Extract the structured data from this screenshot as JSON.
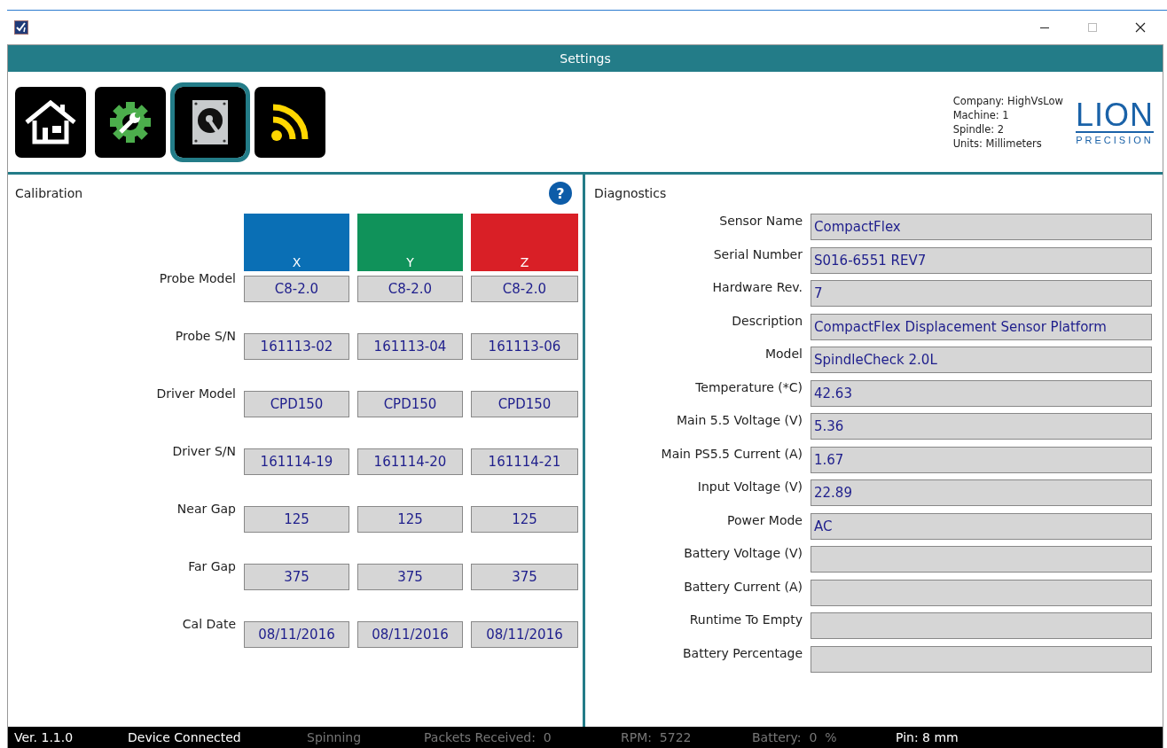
{
  "header": {
    "title": "Settings"
  },
  "toolbar": [
    {
      "kind": "home",
      "selected": false
    },
    {
      "kind": "settings",
      "selected": false
    },
    {
      "kind": "drive",
      "selected": true
    },
    {
      "kind": "signal",
      "selected": false
    }
  ],
  "info": [
    "Company: HighVsLow",
    "Machine: 1",
    "Spindle: 2",
    "Units: Millimeters"
  ],
  "logo": {
    "name": "LION",
    "tagline": "PRECISION"
  },
  "calibration": {
    "title": "Calibration",
    "help": "?",
    "columns": [
      {
        "label": "X",
        "color": "#0a6fb5"
      },
      {
        "label": "Y",
        "color": "#10925a"
      },
      {
        "label": "Z",
        "color": "#d91f26"
      }
    ],
    "rows": [
      {
        "label": "Probe Model",
        "values": [
          "C8-2.0",
          "C8-2.0",
          "C8-2.0"
        ]
      },
      {
        "label": "Probe S/N",
        "values": [
          "161113-02",
          "161113-04",
          "161113-06"
        ]
      },
      {
        "label": "Driver Model",
        "values": [
          "CPD150",
          "CPD150",
          "CPD150"
        ]
      },
      {
        "label": "Driver S/N",
        "values": [
          "161114-19",
          "161114-20",
          "161114-21"
        ]
      },
      {
        "label": "Near Gap",
        "values": [
          "125",
          "125",
          "125"
        ]
      },
      {
        "label": "Far Gap",
        "values": [
          "375",
          "375",
          "375"
        ]
      },
      {
        "label": "Cal Date",
        "values": [
          "08/11/2016",
          "08/11/2016",
          "08/11/2016"
        ]
      }
    ]
  },
  "diagnostics": {
    "title": "Diagnostics",
    "rows": [
      {
        "label": "Sensor Name",
        "value": "CompactFlex"
      },
      {
        "label": "Serial Number",
        "value": "S016-6551 REV7"
      },
      {
        "label": "Hardware Rev.",
        "value": "7"
      },
      {
        "label": "Description",
        "value": "CompactFlex Displacement Sensor Platform"
      },
      {
        "label": "Model",
        "value": "SpindleCheck 2.0L"
      },
      {
        "label": "Temperature (*C)",
        "value": "42.63"
      },
      {
        "label": "Main 5.5 Voltage (V)",
        "value": "5.36"
      },
      {
        "label": "Main PS5.5 Current (A)",
        "value": "1.67"
      },
      {
        "label": "Input Voltage (V)",
        "value": "22.89"
      },
      {
        "label": "Power Mode",
        "value": "AC"
      },
      {
        "label": "Battery Voltage (V)"
      },
      {
        "label": "Battery Current (A)"
      },
      {
        "label": "Runtime To Empty"
      },
      {
        "label": "Battery Percentage"
      }
    ]
  },
  "status_bar": [
    {
      "text": "Ver. 1.1.0",
      "active": true
    },
    {
      "text": "Device Connected",
      "active": true
    },
    {
      "text": "Spinning",
      "active": false
    },
    {
      "text": "Packets Received:  0",
      "active": false
    },
    {
      "text": "RPM:  5722",
      "active": false
    },
    {
      "text": "Battery:  0  %",
      "active": false
    },
    {
      "text": "Pin: 8 mm",
      "active": true
    }
  ]
}
